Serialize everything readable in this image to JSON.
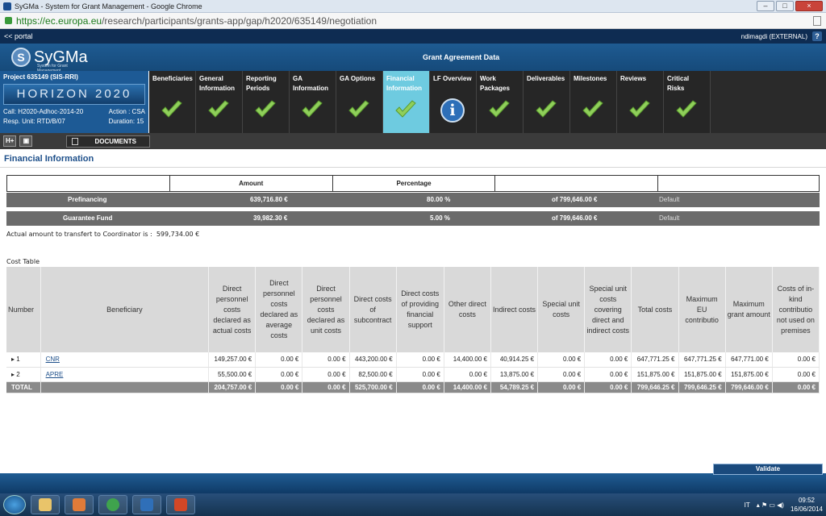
{
  "window": {
    "title": "SyGMa - System for Grant Management - Google Chrome",
    "minimize": "–",
    "maximize": "□",
    "close": "×"
  },
  "browser": {
    "url_host": "https://ec.europa.eu",
    "url_path": "/research/participants/grants-app/gap/h2020/635149/negotiation"
  },
  "portal": {
    "back_link": "<< portal",
    "user": "ndimagdi (EXTERNAL)",
    "help": "?"
  },
  "app": {
    "logo_name": "SyGMa",
    "logo_sub": "System for Grant Management",
    "header_title": "Grant Agreement Data"
  },
  "project": {
    "title": "Project 635149 (SIS-RRI)",
    "banner": "HORIZON 2020",
    "call": "Call: H2020-Adhoc-2014-20",
    "action": "Action : CSA",
    "unit": "Resp. Unit: RTD/B/07",
    "duration": "Duration: 15"
  },
  "tabs": [
    {
      "label": "Beneficiaries",
      "icon": "check-icon",
      "active": false
    },
    {
      "label": "General Information",
      "icon": "check-icon",
      "active": false
    },
    {
      "label": "Reporting Periods",
      "icon": "check-icon",
      "active": false
    },
    {
      "label": "GA Information",
      "icon": "check-icon",
      "active": false
    },
    {
      "label": "GA Options",
      "icon": "check-icon",
      "active": false
    },
    {
      "label": "Financial Information",
      "icon": "check-icon",
      "active": true
    },
    {
      "label": "LF Overview",
      "icon": "info-icon",
      "active": false
    },
    {
      "label": "Work Packages",
      "icon": "check-icon",
      "active": false
    },
    {
      "label": "Deliverables",
      "icon": "check-icon",
      "active": false
    },
    {
      "label": "Milestones",
      "icon": "check-icon",
      "active": false
    },
    {
      "label": "Reviews",
      "icon": "check-icon",
      "active": false
    },
    {
      "label": "Critical Risks",
      "icon": "check-icon",
      "active": false
    }
  ],
  "toolbar": {
    "btn_h": "H+",
    "btn_print": "▣",
    "documents": "DOCUMENTS"
  },
  "financial": {
    "section_title": "Financial Information",
    "headers": {
      "amount": "Amount",
      "percentage": "Percentage"
    },
    "prefinancing": {
      "label": "Prefinancing",
      "amount": "639,716.80 €",
      "percentage": "80.00 %",
      "of": "of 799,646.00 €",
      "note": "Default"
    },
    "guarantee": {
      "label": "Guarantee Fund",
      "amount": "39,982.30 €",
      "percentage": "5.00 %",
      "of": "of 799,646.00 €",
      "note": "Default"
    },
    "actual_label": "Actual amount to transfert to Coordinator is :",
    "actual_value": "599,734.00 €"
  },
  "cost_table": {
    "label": "Cost Table",
    "columns": [
      "Number",
      "Beneficiary",
      "Direct personnel costs declared as actual costs",
      "Direct personnel costs declared as average costs",
      "Direct personnel costs declared as unit costs",
      "Direct costs of subcontract",
      "Direct costs of providing financial support",
      "Other direct costs",
      "Indirect costs",
      "Special unit costs",
      "Special unit costs covering direct and indirect costs",
      "Total costs",
      "Maximum EU contributio",
      "Maximum grant amount",
      "Costs of in-kind contributio not used on premises"
    ],
    "rows": [
      {
        "number": "▸ 1",
        "beneficiary": "CNR",
        "c1": "149,257.00 €",
        "c2": "0.00 €",
        "c3": "0.00 €",
        "c4": "443,200.00 €",
        "c5": "0.00 €",
        "c6": "14,400.00 €",
        "c7": "40,914.25 €",
        "c8": "0.00 €",
        "c9": "0.00 €",
        "c10": "647,771.25 €",
        "c11": "647,771.25 €",
        "c12": "647,771.00 €",
        "c13": "0.00 €"
      },
      {
        "number": "▸ 2",
        "beneficiary": "APRE",
        "c1": "55,500.00 €",
        "c2": "0.00 €",
        "c3": "0.00 €",
        "c4": "82,500.00 €",
        "c5": "0.00 €",
        "c6": "0.00 €",
        "c7": "13,875.00 €",
        "c8": "0.00 €",
        "c9": "0.00 €",
        "c10": "151,875.00 €",
        "c11": "151,875.00 €",
        "c12": "151,875.00 €",
        "c13": "0.00 €"
      }
    ],
    "total": {
      "number": "TOTAL",
      "beneficiary": "",
      "c1": "204,757.00 €",
      "c2": "0.00 €",
      "c3": "0.00 €",
      "c4": "525,700.00 €",
      "c5": "0.00 €",
      "c6": "14,400.00 €",
      "c7": "54,789.25 €",
      "c8": "0.00 €",
      "c9": "0.00 €",
      "c10": "799,646.25 €",
      "c11": "799,646.25 €",
      "c12": "799,646.00 €",
      "c13": "0.00 €"
    }
  },
  "validate_label": "Validate",
  "taskbar": {
    "lang": "IT",
    "time": "09:52",
    "date": "16/06/2014"
  },
  "colors": {
    "header_blue": "#1e5b92",
    "active_tab": "#6ecbe0",
    "check_green": "#8fcf5a"
  }
}
